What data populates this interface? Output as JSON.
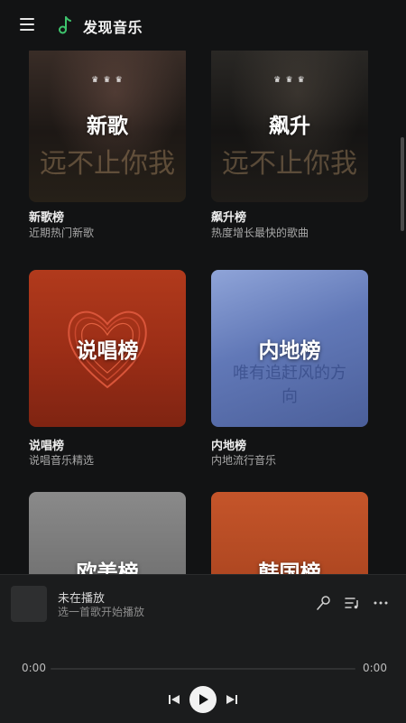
{
  "header": {
    "title": "发现音乐"
  },
  "charts": [
    {
      "cover_title": "新歌",
      "cover_sub": "",
      "cover_art": "远不止你我",
      "name": "新歌榜",
      "desc": "近期热门新歌"
    },
    {
      "cover_title": "飙升",
      "cover_sub": "",
      "cover_art": "远不止你我",
      "name": "飙升榜",
      "desc": "热度增长最快的歌曲"
    },
    {
      "cover_title": "说唱榜",
      "name": "说唱榜",
      "desc": "说唱音乐精选"
    },
    {
      "cover_title": "内地榜",
      "cover_art": "唯有追赶风的方向",
      "name": "内地榜",
      "desc": "内地流行音乐"
    },
    {
      "cover_title": "欧美榜"
    },
    {
      "cover_title": "韩国榜"
    }
  ],
  "player": {
    "title": "未在播放",
    "subtitle": "选一首歌开始播放",
    "time_current": "0:00",
    "time_total": "0:00",
    "progress": 0
  },
  "colors": {
    "accent": "#3ec46d",
    "background": "#121314",
    "player_bg": "#1b1c1d"
  },
  "icons": [
    "menu-icon",
    "music-note-icon",
    "microphone-icon",
    "playlist-icon",
    "more-icon",
    "previous-icon",
    "play-icon",
    "next-icon"
  ]
}
